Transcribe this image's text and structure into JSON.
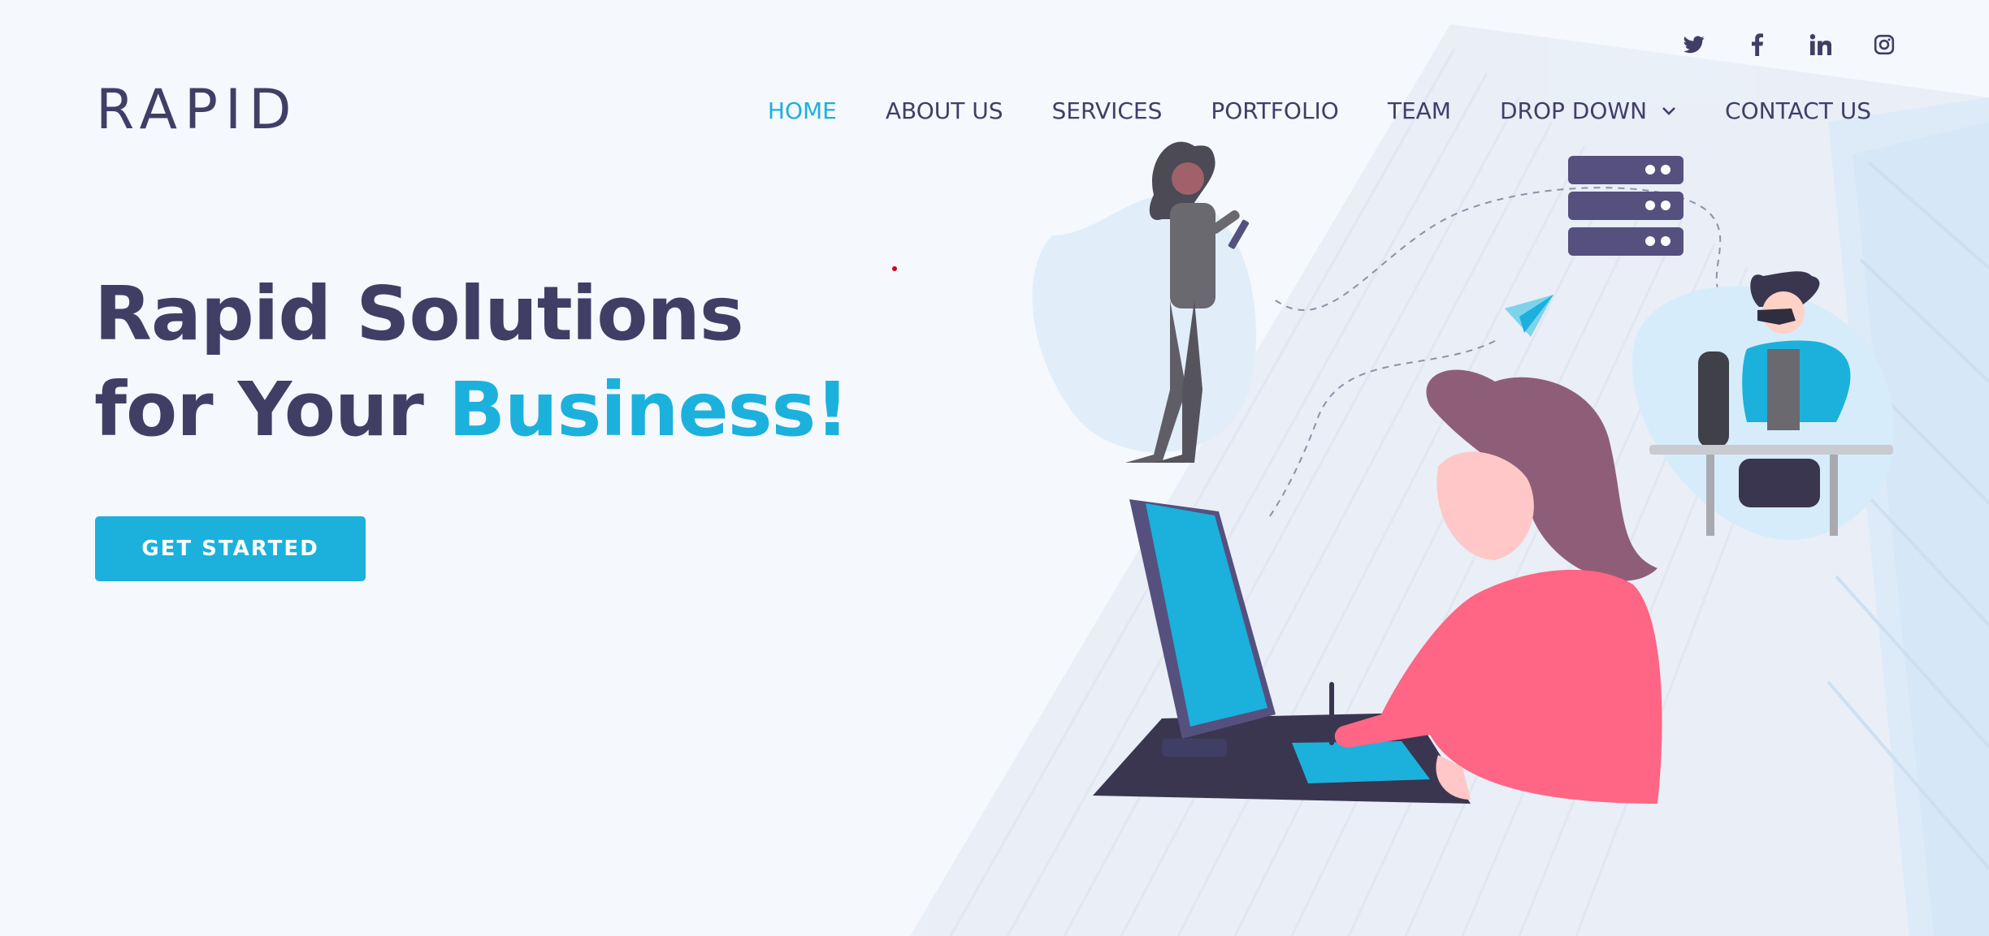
{
  "brand": {
    "logo": "RAPID"
  },
  "social": [
    {
      "icon": "twitter-icon"
    },
    {
      "icon": "facebook-icon"
    },
    {
      "icon": "linkedin-icon"
    },
    {
      "icon": "instagram-icon"
    }
  ],
  "nav": {
    "items": [
      {
        "label": "HOME",
        "active": true
      },
      {
        "label": "ABOUT US"
      },
      {
        "label": "SERVICES"
      },
      {
        "label": "PORTFOLIO"
      },
      {
        "label": "TEAM"
      },
      {
        "label": "DROP DOWN",
        "has_dropdown": true
      },
      {
        "label": "CONTACT US"
      }
    ]
  },
  "hero": {
    "line1": "Rapid Solutions",
    "line2_prefix": "for Your ",
    "line2_accent": "Business!",
    "cta_label": "GET STARTED"
  },
  "colors": {
    "accent": "#1bb1dc",
    "text": "#413e66",
    "background": "#f5f8fd",
    "illustration_pink": "#ff6584",
    "server_purple": "#55507e"
  }
}
